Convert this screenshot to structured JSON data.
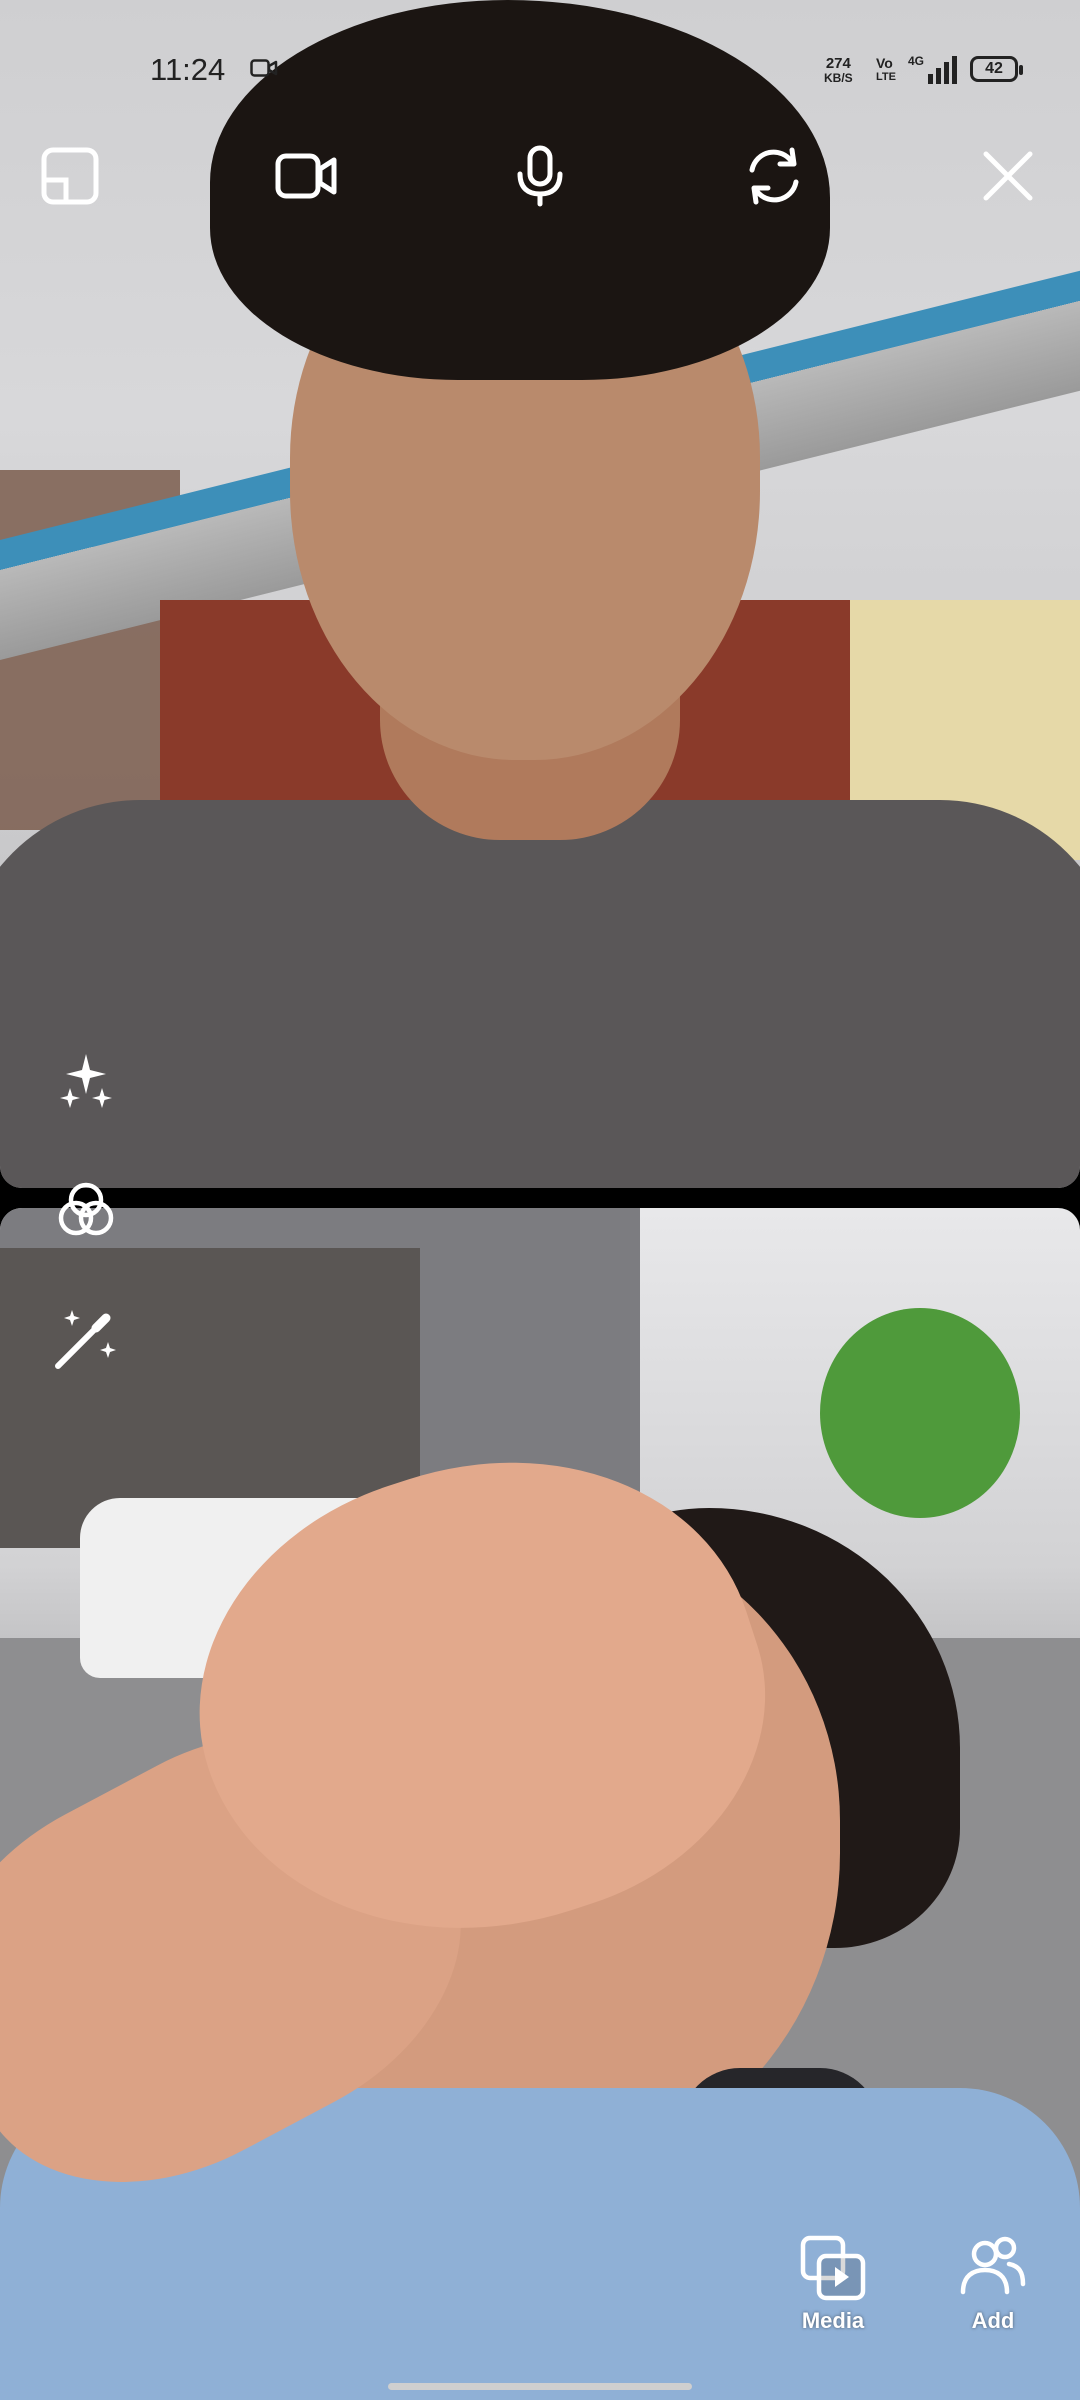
{
  "status_bar": {
    "time": "11:24",
    "net_speed_value": "274",
    "net_speed_unit": "KB/S",
    "volte_top": "Vo",
    "volte_bottom": "LTE",
    "network": "4G",
    "battery": "42"
  },
  "top_controls": [
    {
      "name": "layout-icon"
    },
    {
      "name": "video-camera-icon"
    },
    {
      "name": "microphone-icon"
    },
    {
      "name": "flip-camera-icon"
    },
    {
      "name": "close-icon"
    }
  ],
  "side_tools": [
    {
      "name": "sparkles-effects-icon"
    },
    {
      "name": "filters-circles-icon"
    },
    {
      "name": "magic-wand-icon"
    }
  ],
  "actions": {
    "media_label": "Media",
    "add_label": "Add"
  },
  "colors": {
    "icon": "#ffffff",
    "status_text": "#222222"
  }
}
